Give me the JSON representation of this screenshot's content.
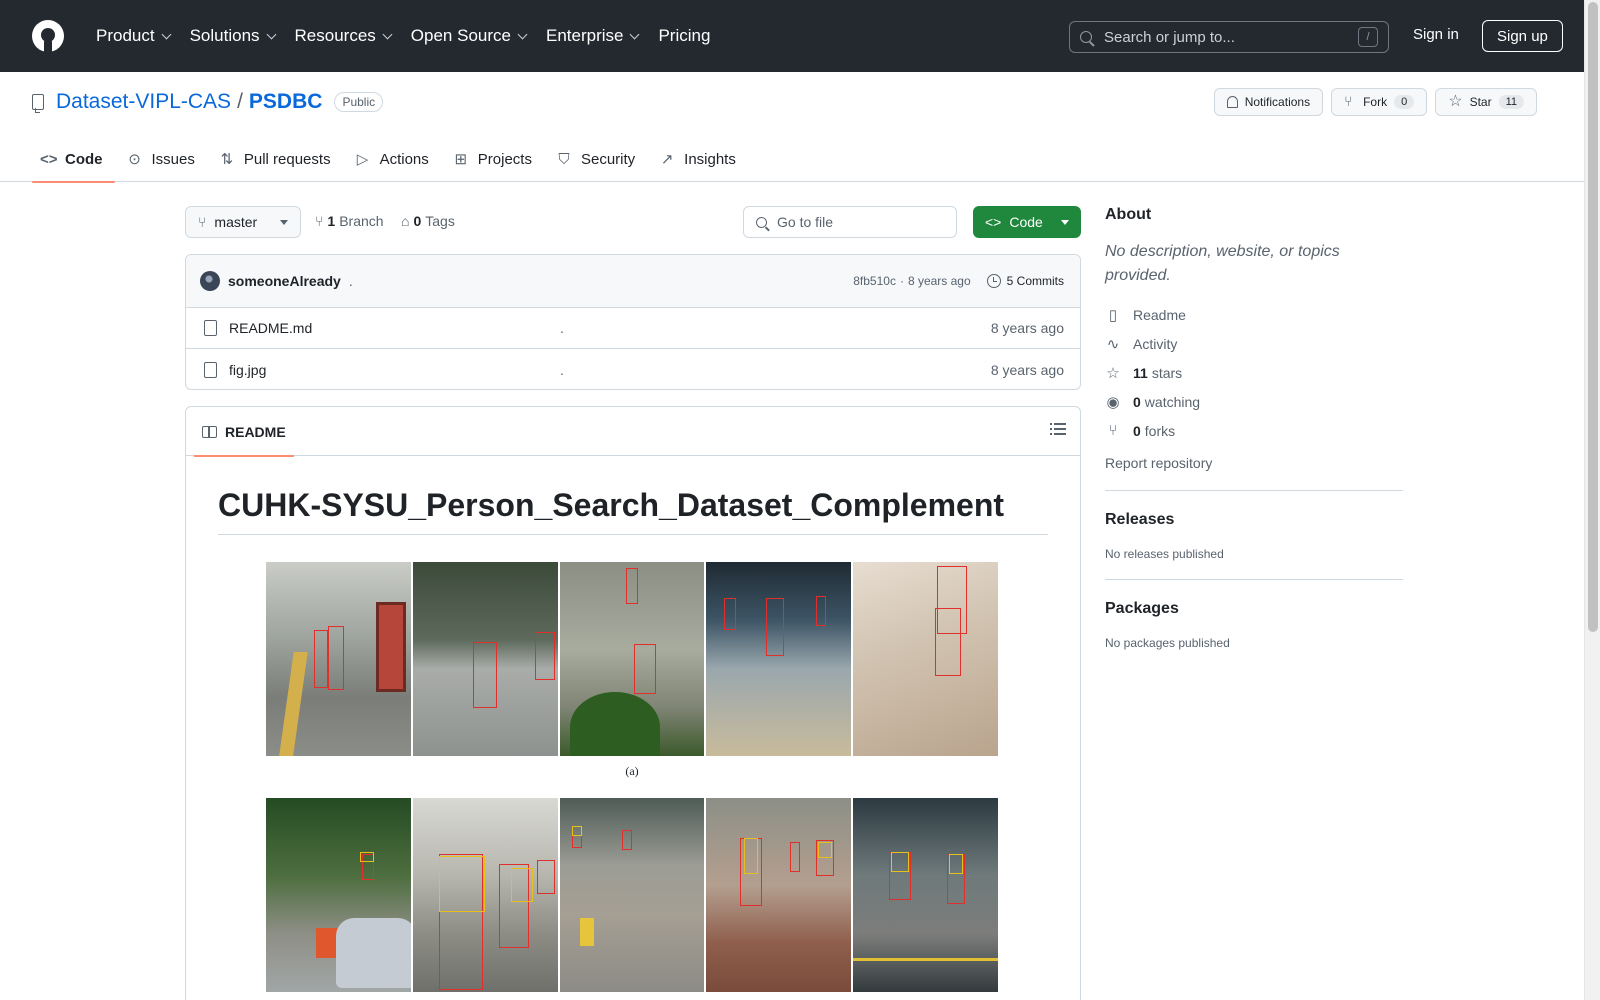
{
  "header": {
    "nav": [
      "Product",
      "Solutions",
      "Resources",
      "Open Source",
      "Enterprise",
      "Pricing"
    ],
    "search_placeholder": "Search or jump to...",
    "search_shortcut": "/",
    "sign_in": "Sign in",
    "sign_up": "Sign up"
  },
  "repo": {
    "owner": "Dataset-VIPL-CAS",
    "separator": "/",
    "name": "PSDBC",
    "visibility": "Public",
    "notifications_label": "Notifications",
    "fork_label": "Fork",
    "fork_count": "0",
    "star_label": "Star",
    "star_count": "11",
    "tabs": [
      {
        "label": "Code",
        "icon": "code-icon"
      },
      {
        "label": "Issues",
        "icon": "issue-icon"
      },
      {
        "label": "Pull requests",
        "icon": "pull-request-icon"
      },
      {
        "label": "Actions",
        "icon": "play-icon"
      },
      {
        "label": "Projects",
        "icon": "table-icon"
      },
      {
        "label": "Security",
        "icon": "shield-icon"
      },
      {
        "label": "Insights",
        "icon": "graph-icon"
      }
    ]
  },
  "filebar": {
    "branch": "master",
    "branch_count": "1",
    "branch_label": "Branch",
    "tag_count": "0",
    "tag_label": "Tags",
    "goto_placeholder": "Go to file",
    "code_button": "Code"
  },
  "commit": {
    "author": "someoneAlready",
    "message": ".",
    "hash": "8fb510c",
    "dot": "·",
    "time": "8 years ago",
    "commits_label": "5 Commits"
  },
  "files": [
    {
      "name": "README.md",
      "message": ".",
      "time": "8 years ago"
    },
    {
      "name": "fig.jpg",
      "message": ".",
      "time": "8 years ago"
    }
  ],
  "readme": {
    "tab_label": "README",
    "title": "CUHK-SYSU_Person_Search_Dataset_Complement",
    "figure_caption": "(a)"
  },
  "about": {
    "heading": "About",
    "description": "No description, website, or topics provided.",
    "readme": "Readme",
    "activity": "Activity",
    "stars_count": "11",
    "stars_label": "stars",
    "watching_count": "0",
    "watching_label": "watching",
    "forks_count": "0",
    "forks_label": "forks",
    "report": "Report repository"
  },
  "releases": {
    "heading": "Releases",
    "empty": "No releases published"
  },
  "packages": {
    "heading": "Packages",
    "empty": "No packages published"
  },
  "colors": {
    "header_bg": "#24292f",
    "link": "#0969da",
    "primary_button": "#1f883d",
    "tab_underline": "#fd8c73",
    "bbox": "#e0302b"
  }
}
